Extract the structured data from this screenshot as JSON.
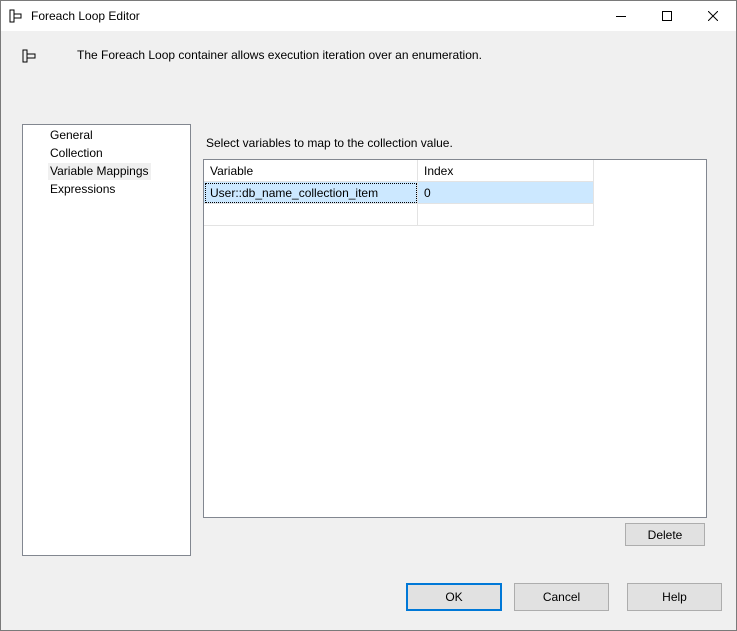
{
  "window": {
    "title": "Foreach Loop Editor"
  },
  "header": {
    "description": "The Foreach Loop container allows execution iteration over an enumeration."
  },
  "nav": {
    "items": [
      {
        "label": "General"
      },
      {
        "label": "Collection"
      },
      {
        "label": "Variable Mappings",
        "selected": true
      },
      {
        "label": "Expressions"
      }
    ]
  },
  "mappings": {
    "instruction": "Select variables to map to the collection value.",
    "columns": [
      "Variable",
      "Index"
    ],
    "rows": [
      {
        "variable": "User::db_name_collection_item",
        "index": "0",
        "selected": true
      },
      {
        "variable": "",
        "index": ""
      }
    ],
    "delete_label": "Delete"
  },
  "footer": {
    "ok_label": "OK",
    "cancel_label": "Cancel",
    "help_label": "Help"
  },
  "colors": {
    "selection": "#cce8ff",
    "default_button_border": "#0078d7",
    "button_face": "#e1e1e1"
  },
  "icons": {
    "title": "foreach-container-icon",
    "header": "foreach-container-icon",
    "minimize": "minimize-icon",
    "maximize": "maximize-icon",
    "close": "close-icon"
  }
}
